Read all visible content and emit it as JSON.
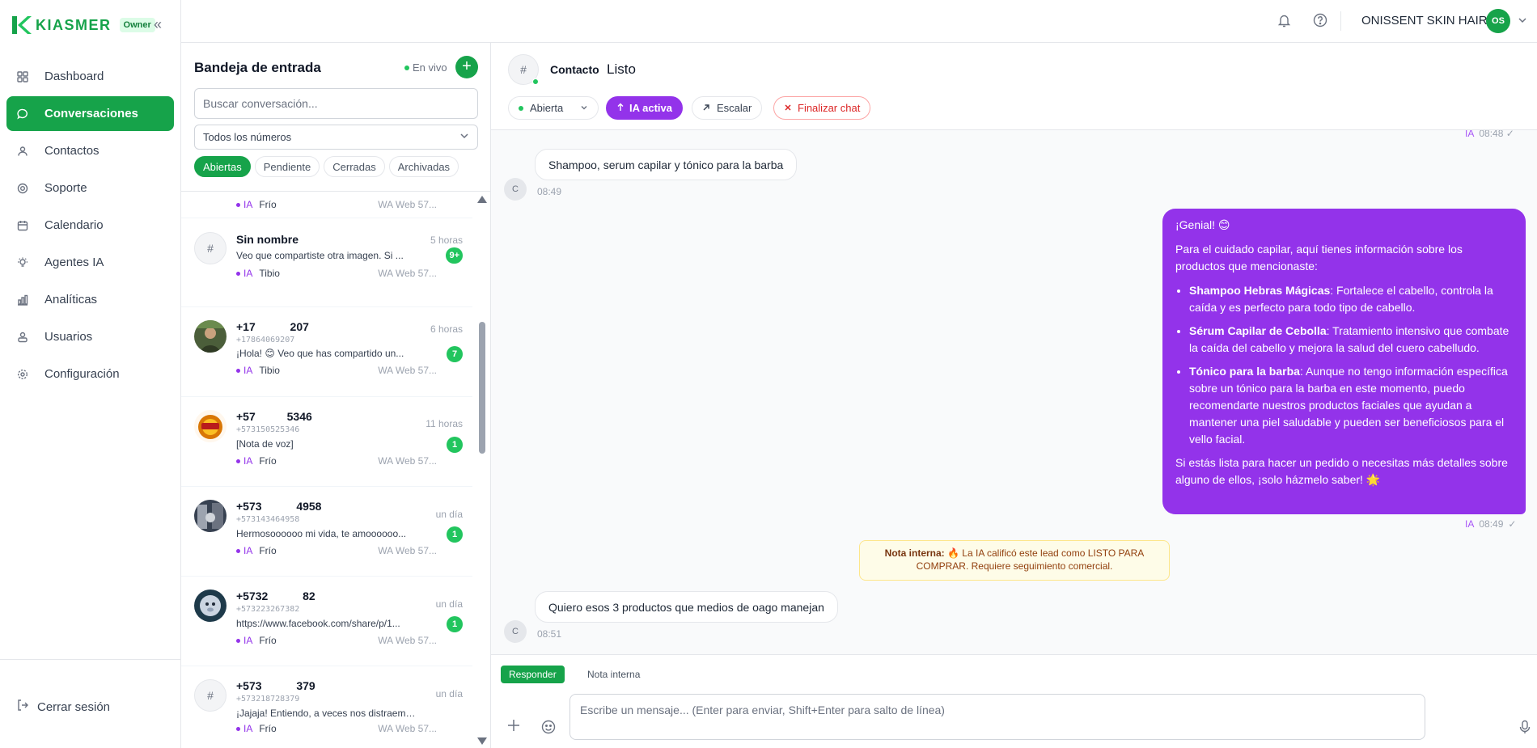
{
  "brand": {
    "name": "KIASMER",
    "role": "Owner"
  },
  "sidebar": {
    "items": [
      {
        "label": "Dashboard",
        "icon": "grid-icon"
      },
      {
        "label": "Conversaciones",
        "icon": "chat-icon",
        "active": true
      },
      {
        "label": "Contactos",
        "icon": "contacts-icon"
      },
      {
        "label": "Soporte",
        "icon": "lifebuoy-icon"
      },
      {
        "label": "Calendario",
        "icon": "calendar-icon"
      },
      {
        "label": "Agentes IA",
        "icon": "lightbulb-icon"
      },
      {
        "label": "Analíticas",
        "icon": "bar-chart-icon"
      },
      {
        "label": "Usuarios",
        "icon": "users-icon"
      },
      {
        "label": "Configuración",
        "icon": "gear-icon"
      }
    ],
    "logout": "Cerrar sesión"
  },
  "topbar": {
    "org": "ONISSENT SKIN HAIR",
    "avatar": "OS"
  },
  "inbox": {
    "title": "Bandeja de entrada",
    "live": "En vivo",
    "add": "+",
    "search_placeholder": "Buscar conversación...",
    "numbers": "Todos los números",
    "filters": [
      "Abiertas",
      "Pendiente",
      "Cerradas",
      "Archivadas"
    ],
    "conversations": [
      {
        "name": "",
        "time": "",
        "phone": "",
        "preview": "",
        "badge": "",
        "ia": "IA",
        "temp": "Frío",
        "source": "WA Web 57..."
      },
      {
        "name": "Sin nombre",
        "time": "5 horas",
        "phone": "",
        "preview": "Veo que compartiste otra imagen. Si ...",
        "badge": "9+",
        "ia": "IA",
        "temp": "Tibio",
        "source": "WA Web 57..."
      },
      {
        "name": "+17           207",
        "time": "6 horas",
        "phone": "+17864069207",
        "preview": "¡Hola! 😊 Veo que has compartido un...",
        "badge": "7",
        "ia": "IA",
        "temp": "Tibio",
        "source": "WA Web 57..."
      },
      {
        "name": "+57          5346",
        "time": "11 horas",
        "phone": "+573150525346",
        "preview": "[Nota de voz]",
        "badge": "1",
        "ia": "IA",
        "temp": "Frío",
        "source": "WA Web 57..."
      },
      {
        "name": "+573           4958",
        "time": "un día",
        "phone": "+573143464958",
        "preview": "Hermosoooooo mi vida, te amoooooo...",
        "badge": "1",
        "ia": "IA",
        "temp": "Frío",
        "source": "WA Web 57..."
      },
      {
        "name": "+5732           82",
        "time": "un día",
        "phone": "+573223267382",
        "preview": "https://www.facebook.com/share/p/1...",
        "badge": "1",
        "ia": "IA",
        "temp": "Frío",
        "source": "WA Web 57..."
      },
      {
        "name": "+573           379",
        "time": "un día",
        "phone": "+573218728379",
        "preview": "¡Jajaja! Entiendo, a veces nos distraemos. ...",
        "badge": "",
        "ia": "IA",
        "temp": "Frío",
        "source": "WA Web 57..."
      }
    ]
  },
  "chat": {
    "avatar": "#",
    "contact_label": "Contacto",
    "contact_name": "Listo",
    "state": "Abierta",
    "ia_active": "IA activa",
    "escalate": "Escalar",
    "end_chat": "Finalizar chat",
    "top_time": {
      "ia": "IA",
      "time": "08:48",
      "tick": "✓"
    },
    "msg1": {
      "avatar": "C",
      "text": "Shampoo, serum capilar y tónico para la barba",
      "time": "08:49"
    },
    "reply": {
      "greeting": "¡Genial! 😊",
      "intro": "Para el cuidado capilar, aquí tienes información sobre los productos que mencionaste:",
      "items": [
        {
          "title": "Shampoo Hebras Mágicas",
          "text": ": Fortalece el cabello, controla la caída y es perfecto para todo tipo de cabello."
        },
        {
          "title": "Sérum Capilar de Cebolla",
          "text": ": Tratamiento intensivo que combate la caída del cabello y mejora la salud del cuero cabelludo."
        },
        {
          "title": "Tónico para la barba",
          "text": ": Aunque no tengo información específica sobre un tónico para la barba en este momento, puedo recomendarte nuestros productos faciales que ayudan a mantener una piel saludable y pueden ser beneficiosos para el vello facial."
        }
      ],
      "closing": "Si estás lista para hacer un pedido o necesitas más detalles sobre alguno de ellos, ¡solo házmelo saber! 🌟",
      "ia": "IA",
      "time": "08:49",
      "tick": "✓"
    },
    "note": {
      "label": "Nota interna:",
      "text": "🔥 La IA calificó este lead como LISTO PARA COMPRAR. Requiere seguimiento comercial."
    },
    "msg2": {
      "avatar": "C",
      "text": "Quiero esos 3 productos que medios de oago manejan",
      "time": "08:51"
    },
    "composer": {
      "reply_tab": "Responder",
      "note_tab": "Nota interna",
      "placeholder": "Escribe un mensaje... (Enter para enviar, Shift+Enter para salto de línea)"
    }
  }
}
